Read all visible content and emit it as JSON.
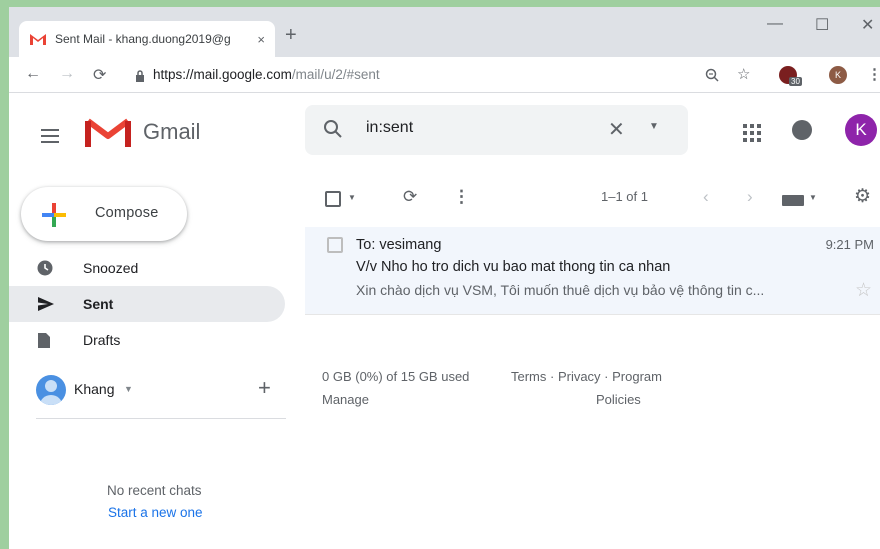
{
  "browser": {
    "tab_title": "Sent Mail - khang.duong2019@g",
    "tab_close": "×",
    "new_tab": "+",
    "url_host": "https://mail.google.com",
    "url_path": "/mail/u/2/#sent",
    "window_controls": {
      "minimize": "—",
      "maximize": "☐",
      "close": "✕"
    },
    "extension_badge": "30",
    "profile_initial": "K"
  },
  "gmail": {
    "app_name": "Gmail",
    "search_query": "in:sent",
    "avatar_initial": "K"
  },
  "sidebar": {
    "compose_label": "Compose",
    "items": [
      {
        "label": "Snoozed",
        "icon": "clock-icon"
      },
      {
        "label": "Sent",
        "icon": "send-icon",
        "active": true
      },
      {
        "label": "Drafts",
        "icon": "draft-icon"
      }
    ],
    "hangouts_user": "Khang",
    "no_chats": "No recent chats",
    "start_new": "Start a new one"
  },
  "toolbar": {
    "pagination": "1–1 of 1"
  },
  "email": {
    "to": "To: vesimang",
    "time": "9:21 PM",
    "subject": "V/v Nho ho tro dich vu bao mat thong tin ca nhan",
    "snippet": "Xin chào dịch vụ VSM, Tôi muốn thuê dịch vụ bảo vệ thông tin c..."
  },
  "footer": {
    "storage": "0 GB (0%) of 15 GB used",
    "manage": "Manage",
    "terms": "Terms · Privacy · Program",
    "policies": "Policies"
  },
  "colors": {
    "accent": "#8e24aa",
    "link": "#1a73e8",
    "gmail_red": "#ea4335"
  }
}
